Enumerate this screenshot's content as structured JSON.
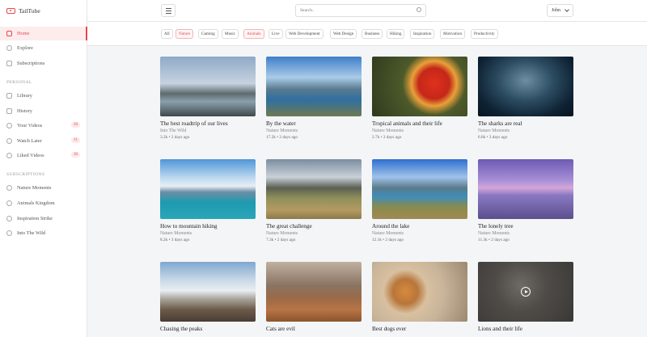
{
  "app": {
    "name": "TailTube"
  },
  "sidebar": {
    "main": [
      {
        "label": "Home",
        "icon": "home-icon",
        "active": true
      },
      {
        "label": "Explore",
        "icon": "compass-icon"
      },
      {
        "label": "Subscriptions",
        "icon": "bolt-icon"
      }
    ],
    "personal_header": "PERSONAL",
    "personal": [
      {
        "label": "Library",
        "icon": "library-icon"
      },
      {
        "label": "History",
        "icon": "history-icon"
      },
      {
        "label": "Your Videos",
        "icon": "play-circle-icon",
        "badge": "26"
      },
      {
        "label": "Watch Later",
        "icon": "clock-icon",
        "badge": "11"
      },
      {
        "label": "Liked Videos",
        "icon": "heart-icon",
        "badge": "36"
      }
    ],
    "subscriptions_header": "SUBSCRIPTIONS",
    "subscriptions": [
      {
        "label": "Nature Moments"
      },
      {
        "label": "Animals Kingdom"
      },
      {
        "label": "Inspiration Strike"
      },
      {
        "label": "Into The Wild"
      }
    ]
  },
  "topbar": {
    "search_placeholder": "Search..",
    "user": "John"
  },
  "chips": [
    "All",
    "Nature",
    "Gaming",
    "Music",
    "Animals",
    "Live",
    "Web Development",
    "Web Design",
    "Business",
    "Hiking",
    "Inspiration",
    "Motivation",
    "Productivity"
  ],
  "videos": [
    {
      "title": "The best roadtrip of our lives",
      "channel": "Into The Wild",
      "meta": "3.2k • 2 days ago"
    },
    {
      "title": "By the water",
      "channel": "Nature Moments",
      "meta": "17.2k • 2 days ago"
    },
    {
      "title": "Tropical animals and their life",
      "channel": "Nature Moments",
      "meta": "2.7k • 3 days ago"
    },
    {
      "title": "The sharks are real",
      "channel": "Nature Moments",
      "meta": "6.8k • 3 days ago"
    },
    {
      "title": "How to mountain hiking",
      "channel": "Nature Moments",
      "meta": "8.2k • 3 days ago"
    },
    {
      "title": "The great challenge",
      "channel": "Nature Moments",
      "meta": "7.3k • 2 days ago"
    },
    {
      "title": "Around the lake",
      "channel": "Nature Moments",
      "meta": "12.1k • 2 days ago"
    },
    {
      "title": "The lonely tree",
      "channel": "Nature Moments",
      "meta": "11.3k • 2 days ago"
    },
    {
      "title": "Chasing the peaks",
      "channel": "",
      "meta": ""
    },
    {
      "title": "Cats are evil",
      "channel": "",
      "meta": ""
    },
    {
      "title": "Best dogs ever",
      "channel": "",
      "meta": ""
    },
    {
      "title": "Lions and their life",
      "channel": "",
      "meta": ""
    }
  ],
  "colors": {
    "accent": "#e5484d"
  }
}
